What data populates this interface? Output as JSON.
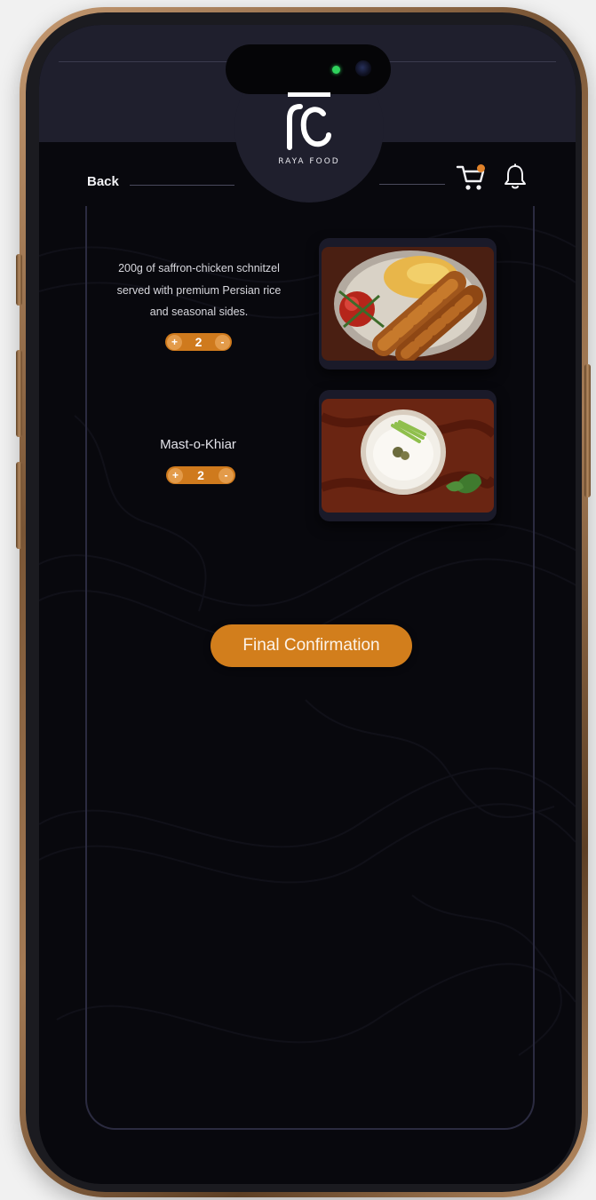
{
  "brand": {
    "name": "RAYA FOOD"
  },
  "nav": {
    "back_label": "Back"
  },
  "items": [
    {
      "description": "200g of saffron-chicken schnitzel served with premium Persian rice and seasonal sides.",
      "quantity": "2",
      "plus": "+",
      "minus": "-"
    },
    {
      "title": "Mast-o-Khiar",
      "quantity": "2",
      "plus": "+",
      "minus": "-"
    }
  ],
  "actions": {
    "confirm_label": "Final Confirmation"
  },
  "icons": {
    "cart": "cart-icon",
    "notification": "bell-icon",
    "logo": "brand-logo"
  },
  "colors": {
    "accent": "#d27e1c",
    "background": "#08080d",
    "header": "#1f1f2d",
    "badge": "#e0822a"
  }
}
